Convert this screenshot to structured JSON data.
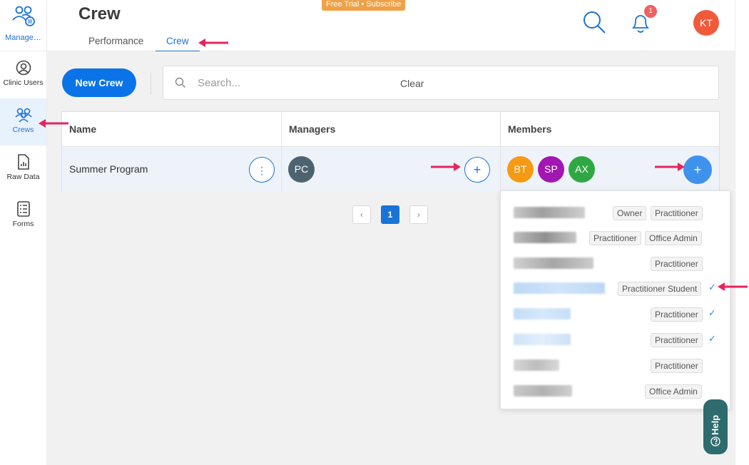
{
  "app": {
    "section_label": "Manage…",
    "trial_banner": "Free Trial • Subscribe",
    "page_title": "Crew"
  },
  "tabs": [
    {
      "label": "Performance"
    },
    {
      "label": "Crew"
    }
  ],
  "sidebar": {
    "items": [
      {
        "label": "Clinic Users",
        "icon": "user-circle-icon"
      },
      {
        "label": "Crews",
        "icon": "users-group-icon"
      },
      {
        "label": "Raw Data",
        "icon": "chart-document-icon"
      },
      {
        "label": "Forms",
        "icon": "form-list-icon"
      }
    ]
  },
  "header": {
    "notification_count": "1",
    "user_initials": "KT"
  },
  "toolbar": {
    "new_crew_label": "New Crew",
    "search_placeholder": "Search...",
    "clear_label": "Clear"
  },
  "table": {
    "columns": [
      "Name",
      "Managers",
      "Members"
    ],
    "rows": [
      {
        "name": "Summer Program",
        "managers": [
          {
            "initials": "PC",
            "color": "#4d6470"
          }
        ],
        "members": [
          {
            "initials": "BT",
            "color": "#f59a12"
          },
          {
            "initials": "SP",
            "color": "#a216b2"
          },
          {
            "initials": "AX",
            "color": "#2fa843"
          }
        ]
      }
    ]
  },
  "pagination": {
    "current_page": "1"
  },
  "member_dropdown": [
    {
      "tags": [
        "Owner",
        "Practitioner"
      ],
      "selected": false
    },
    {
      "tags": [
        "Practitioner",
        "Office Admin"
      ],
      "selected": false
    },
    {
      "tags": [
        "Practitioner"
      ],
      "selected": false
    },
    {
      "tags": [
        "Practitioner Student"
      ],
      "selected": true
    },
    {
      "tags": [
        "Practitioner"
      ],
      "selected": true
    },
    {
      "tags": [
        "Practitioner"
      ],
      "selected": true
    },
    {
      "tags": [
        "Practitioner"
      ],
      "selected": false
    },
    {
      "tags": [
        "Office Admin"
      ],
      "selected": false
    }
  ],
  "help": {
    "label": "Help"
  },
  "colors": {
    "accent": "#1a73d9",
    "new_crew": "#0a73e8",
    "trial": "#f0a045",
    "annotation_arrow": "#e8245c"
  }
}
